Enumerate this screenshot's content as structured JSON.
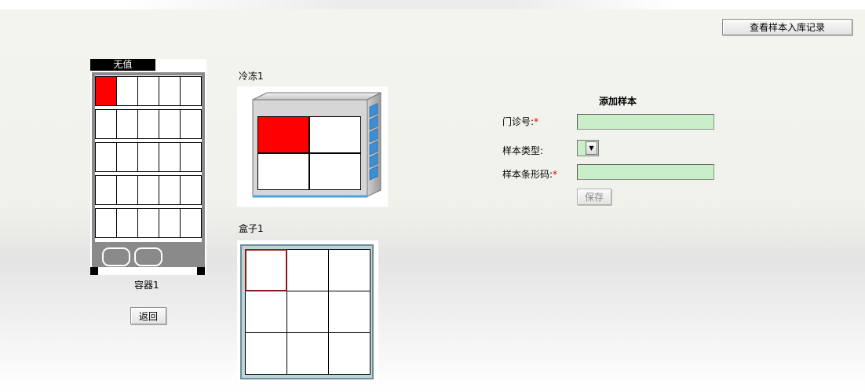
{
  "header": {
    "view_records_label": "查看样本入库记录"
  },
  "container": {
    "status_label": "无值",
    "name": "容器1",
    "back_label": "返回",
    "rows": [
      [
        true,
        false,
        false,
        false,
        false
      ],
      [
        false,
        false,
        false,
        false,
        false
      ],
      [
        false,
        false,
        false,
        false,
        false
      ],
      [
        false,
        false,
        false,
        false,
        false
      ],
      [
        false,
        false,
        false,
        false,
        false
      ]
    ]
  },
  "freezer": {
    "name": "冷冻1",
    "cells": [
      true,
      false,
      false,
      false
    ]
  },
  "box": {
    "name": "盒子1",
    "selected_index": 0
  },
  "form": {
    "title": "添加样本",
    "outpatient_label": "门诊号:",
    "outpatient_value": "",
    "sample_type_label": "样本类型:",
    "sample_type_value": "",
    "barcode_label": "样本条形码:",
    "barcode_value": "",
    "required_mark": "*",
    "save_label": "保存"
  },
  "colors": {
    "filled": "#ff0000",
    "input_bg": "#c9efc9",
    "selected_border": "#8b1a1a"
  }
}
